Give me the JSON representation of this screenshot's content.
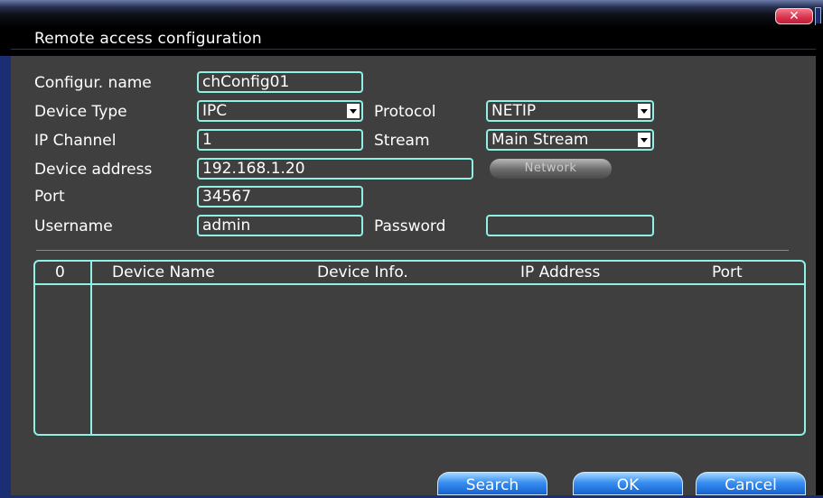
{
  "dialog": {
    "title": "Remote access configuration",
    "close_glyph": "✕"
  },
  "form": {
    "config_name_label": "Configur. name",
    "config_name_value": "chConfig01",
    "device_type_label": "Device Type",
    "device_type_value": "IPC",
    "protocol_label": "Protocol",
    "protocol_value": "NETIP",
    "ip_channel_label": "IP Channel",
    "ip_channel_value": "1",
    "stream_label": "Stream",
    "stream_value": "Main Stream",
    "device_address_label": "Device address",
    "device_address_value": "192.168.1.20",
    "network_button_label": "Network",
    "port_label": "Port",
    "port_value": "34567",
    "username_label": "Username",
    "username_value": "admin",
    "password_label": "Password",
    "password_value": ""
  },
  "table": {
    "columns": [
      "0",
      "Device Name",
      "Device Info.",
      "IP Address",
      "Port"
    ],
    "rows": []
  },
  "buttons": {
    "search": "Search",
    "ok": "OK",
    "cancel": "Cancel"
  },
  "colors": {
    "accent_border": "#8ff0e4",
    "panel_bg": "#3f3f3f",
    "button_blue": "#3a8ff0",
    "close_red": "#d9304a"
  }
}
